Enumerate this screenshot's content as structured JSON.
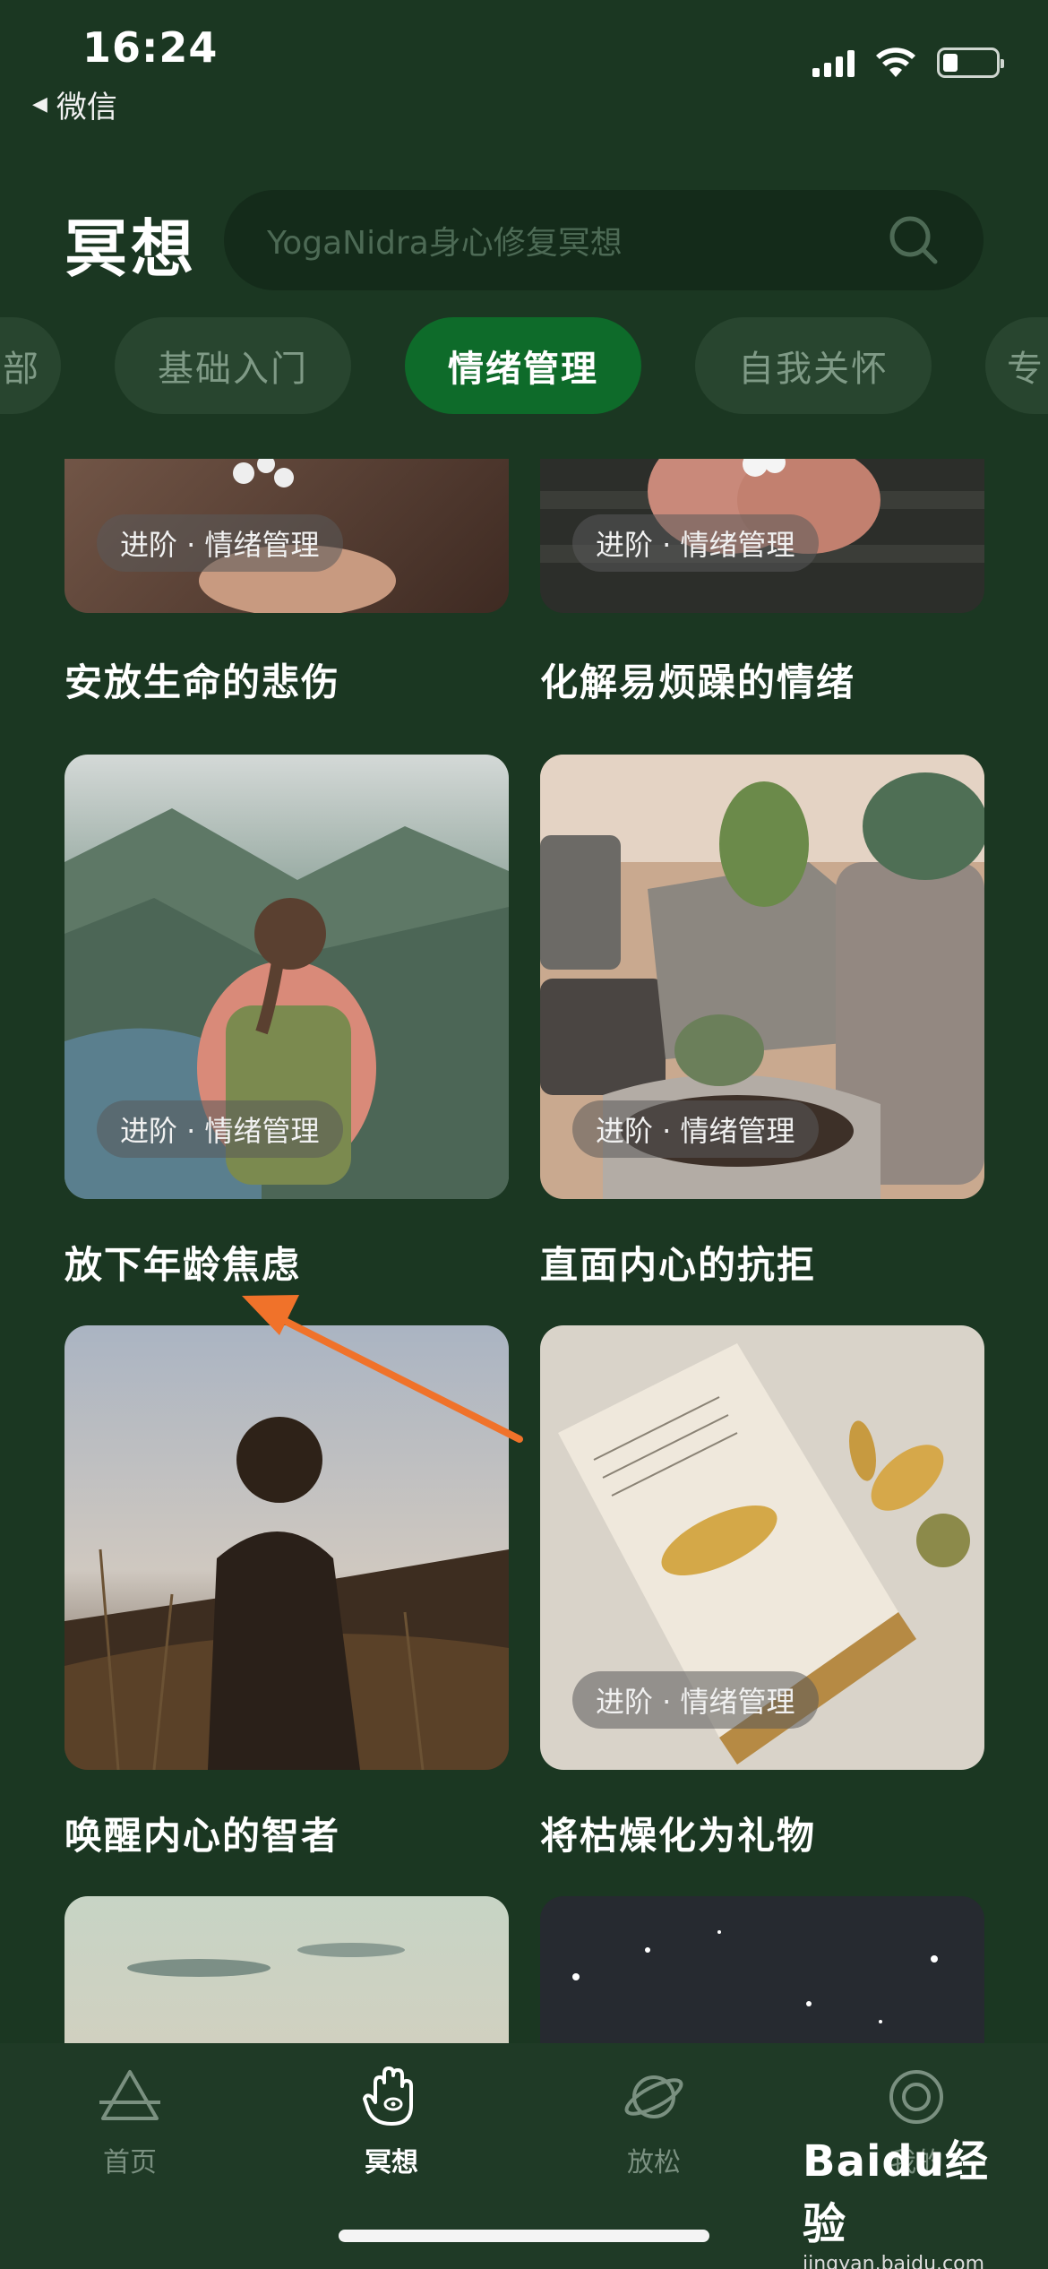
{
  "status_bar": {
    "time": "16:24",
    "back_app": "微信"
  },
  "header": {
    "title": "冥想",
    "search_placeholder": "YogaNidra身心修复冥想"
  },
  "tabs": [
    {
      "label": "部"
    },
    {
      "label": "基础入门"
    },
    {
      "label": "情绪管理",
      "active": true
    },
    {
      "label": "自我关怀"
    },
    {
      "label": "专"
    }
  ],
  "cards": [
    {
      "title": "安放生命的悲伤",
      "tag": "进阶 · 情绪管理"
    },
    {
      "title": "化解易烦躁的情绪",
      "tag": "进阶 · 情绪管理"
    },
    {
      "title": "放下年龄焦虑",
      "tag": "进阶 · 情绪管理"
    },
    {
      "title": "直面内心的抗拒",
      "tag": "进阶 · 情绪管理"
    },
    {
      "title": "唤醒内心的智者",
      "tag": ""
    },
    {
      "title": "将枯燥化为礼物",
      "tag": "进阶 · 情绪管理"
    },
    {
      "title": "",
      "tag": ""
    },
    {
      "title": "",
      "tag": ""
    }
  ],
  "bottom_nav": [
    {
      "label": "首页",
      "icon": "triangle-icon"
    },
    {
      "label": "冥想",
      "icon": "hand-icon",
      "active": true
    },
    {
      "label": "放松",
      "icon": "planet-icon"
    },
    {
      "label": "我的",
      "icon": "target-icon"
    }
  ],
  "watermark": {
    "logo": "Baidu经验",
    "url": "jingyan.baidu.com"
  },
  "colors": {
    "background": "#1b3722",
    "active_tab": "#0e6b2a",
    "annotation_arrow": "#f0722a"
  }
}
